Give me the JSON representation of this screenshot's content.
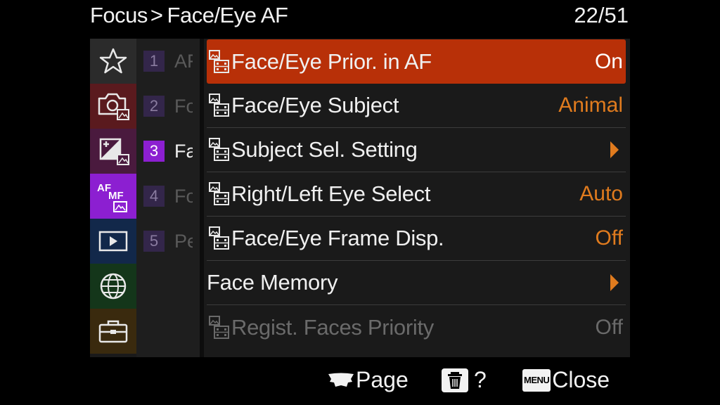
{
  "header": {
    "crumb_root": "Focus",
    "crumb_sep": ">",
    "crumb_current": "Face/Eye AF",
    "page_counter": "22/51"
  },
  "categories": [
    {
      "icon": "star-icon",
      "color": "#2b2b2b"
    },
    {
      "icon": "camera-icon",
      "color": "#5a1a1e"
    },
    {
      "icon": "exposure-icon",
      "color": "#4a1a3e"
    },
    {
      "icon": "af-mf-icon",
      "color": "#8c1fd1",
      "active": true
    },
    {
      "icon": "playback-icon",
      "color": "#12284a"
    },
    {
      "icon": "globe-icon",
      "color": "#14361a"
    },
    {
      "icon": "toolbox-icon",
      "color": "#3a2a0e"
    }
  ],
  "subpages": [
    {
      "num": "1",
      "label": "AF"
    },
    {
      "num": "2",
      "label": "Fo"
    },
    {
      "num": "3",
      "label": "Fa",
      "active": true
    },
    {
      "num": "4",
      "label": "Fo"
    },
    {
      "num": "5",
      "label": "Pe"
    }
  ],
  "items": [
    {
      "title": "Face/Eye Prior. in AF",
      "value": "On",
      "icon": true,
      "selected": true
    },
    {
      "title": "Face/Eye Subject",
      "value": "Animal",
      "icon": true
    },
    {
      "title": "Subject Sel. Setting",
      "value": "",
      "icon": true,
      "arrow": true
    },
    {
      "title": "Right/Left Eye Select",
      "value": "Auto",
      "icon": true
    },
    {
      "title": "Face/Eye Frame Disp.",
      "value": "Off",
      "icon": true
    },
    {
      "title": "Face Memory",
      "value": "",
      "icon": false,
      "arrow": true
    },
    {
      "title": "Regist. Faces Priority",
      "value": "Off",
      "icon": true,
      "disabled": true
    }
  ],
  "footer": {
    "page_label": "Page",
    "delete_label": "?",
    "menu_badge": "MENU",
    "close_label": "Close"
  },
  "colors": {
    "selected": "#b83008",
    "value": "#e07b1e",
    "active_tab": "#8c1fd1"
  }
}
